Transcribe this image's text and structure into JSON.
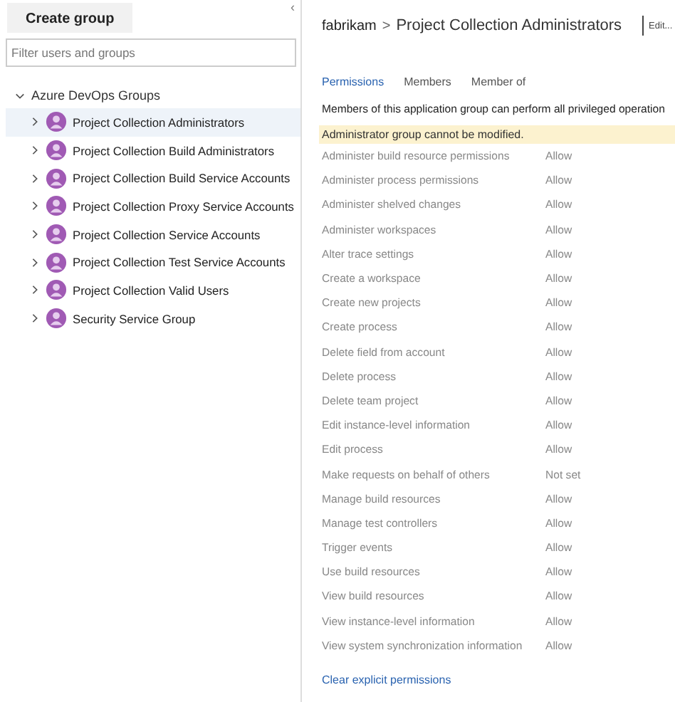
{
  "sidebar": {
    "create_button": "Create group",
    "collapse": "‹",
    "filter": {
      "placeholder": "Filter users and groups"
    },
    "tree": {
      "label": "Azure DevOps Groups",
      "expanded": true,
      "children": [
        {
          "label": "Project Collection Administrators",
          "selected": true
        },
        {
          "label": "Project Collection Build Administrators",
          "selected": false
        },
        {
          "label": "Project Collection Build Service Accounts",
          "selected": false
        },
        {
          "label": "Project Collection Proxy Service Accounts",
          "selected": false
        },
        {
          "label": "Project Collection Service Accounts",
          "selected": false
        },
        {
          "label": "Project Collection Test Service Accounts",
          "selected": false
        },
        {
          "label": "Project Collection Valid Users",
          "selected": false
        },
        {
          "label": "Security Service Group",
          "selected": false
        }
      ]
    }
  },
  "header": {
    "breadcrumb": [
      "fabrikam",
      "Project Collection Administrators"
    ],
    "separator": ">",
    "edit": "Edit..."
  },
  "tabs": [
    {
      "label": "Permissions",
      "selected": true
    },
    {
      "label": "Members",
      "selected": false
    },
    {
      "label": "Member of",
      "selected": false
    }
  ],
  "description": "Members of this application group can perform all privileged operation",
  "notice": "Administrator group cannot be modified.",
  "permissions": [
    {
      "name": "Administer build resource permissions",
      "value": "Allow"
    },
    {
      "name": "Administer process permissions",
      "value": "Allow"
    },
    {
      "name": "Administer shelved changes",
      "value": "Allow"
    },
    {
      "name": "Administer workspaces",
      "value": "Allow"
    },
    {
      "name": "Alter trace settings",
      "value": "Allow"
    },
    {
      "name": "Create a workspace",
      "value": "Allow"
    },
    {
      "name": "Create new projects",
      "value": "Allow"
    },
    {
      "name": "Create process",
      "value": "Allow"
    },
    {
      "name": "Delete field from account",
      "value": "Allow"
    },
    {
      "name": "Delete process",
      "value": "Allow"
    },
    {
      "name": "Delete team project",
      "value": "Allow"
    },
    {
      "name": "Edit instance-level information",
      "value": "Allow"
    },
    {
      "name": "Edit process",
      "value": "Allow"
    },
    {
      "name": "Make requests on behalf of others",
      "value": "Not set"
    },
    {
      "name": "Manage build resources",
      "value": "Allow"
    },
    {
      "name": "Manage test controllers",
      "value": "Allow"
    },
    {
      "name": "Trigger events",
      "value": "Allow"
    },
    {
      "name": "Use build resources",
      "value": "Allow"
    },
    {
      "name": "View build resources",
      "value": "Allow"
    },
    {
      "name": "View instance-level information",
      "value": "Allow"
    },
    {
      "name": "View system synchronization information",
      "value": "Allow"
    }
  ],
  "clear_link": "Clear explicit permissions"
}
